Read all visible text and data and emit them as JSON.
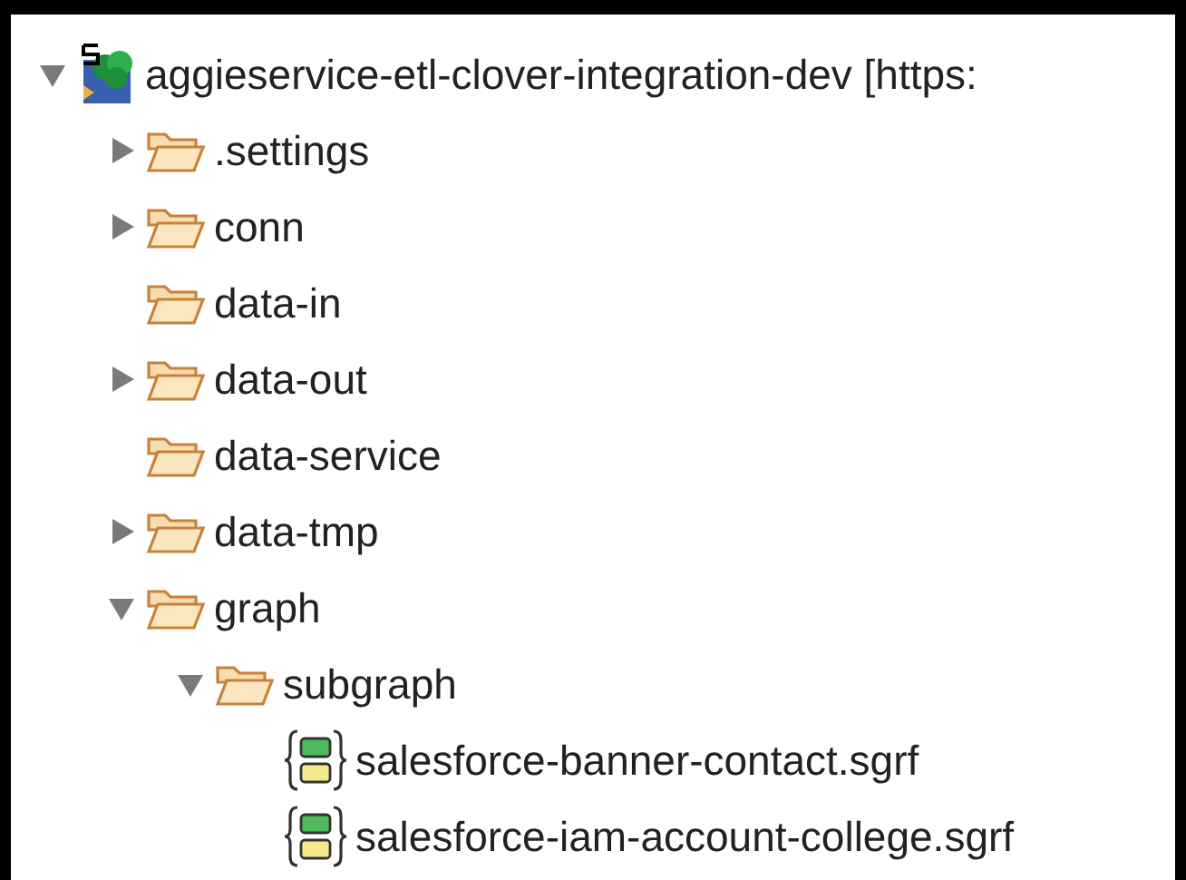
{
  "tree": [
    {
      "kind": "project",
      "label": "aggieservice-etl-clover-integration-dev [https:",
      "expanded": true,
      "children": [
        {
          "kind": "folder",
          "label": ".settings",
          "expanded": false
        },
        {
          "kind": "folder",
          "label": "conn",
          "expanded": false
        },
        {
          "kind": "folder",
          "label": "data-in"
        },
        {
          "kind": "folder",
          "label": "data-out",
          "expanded": false
        },
        {
          "kind": "folder",
          "label": "data-service"
        },
        {
          "kind": "folder",
          "label": "data-tmp",
          "expanded": false
        },
        {
          "kind": "folder",
          "label": "graph",
          "expanded": true,
          "children": [
            {
              "kind": "folder",
              "label": "subgraph",
              "expanded": true,
              "children": [
                {
                  "kind": "file",
                  "label": "salesforce-banner-contact.sgrf"
                },
                {
                  "kind": "file",
                  "label": "salesforce-iam-account-college.sgrf"
                }
              ]
            }
          ]
        }
      ]
    }
  ]
}
